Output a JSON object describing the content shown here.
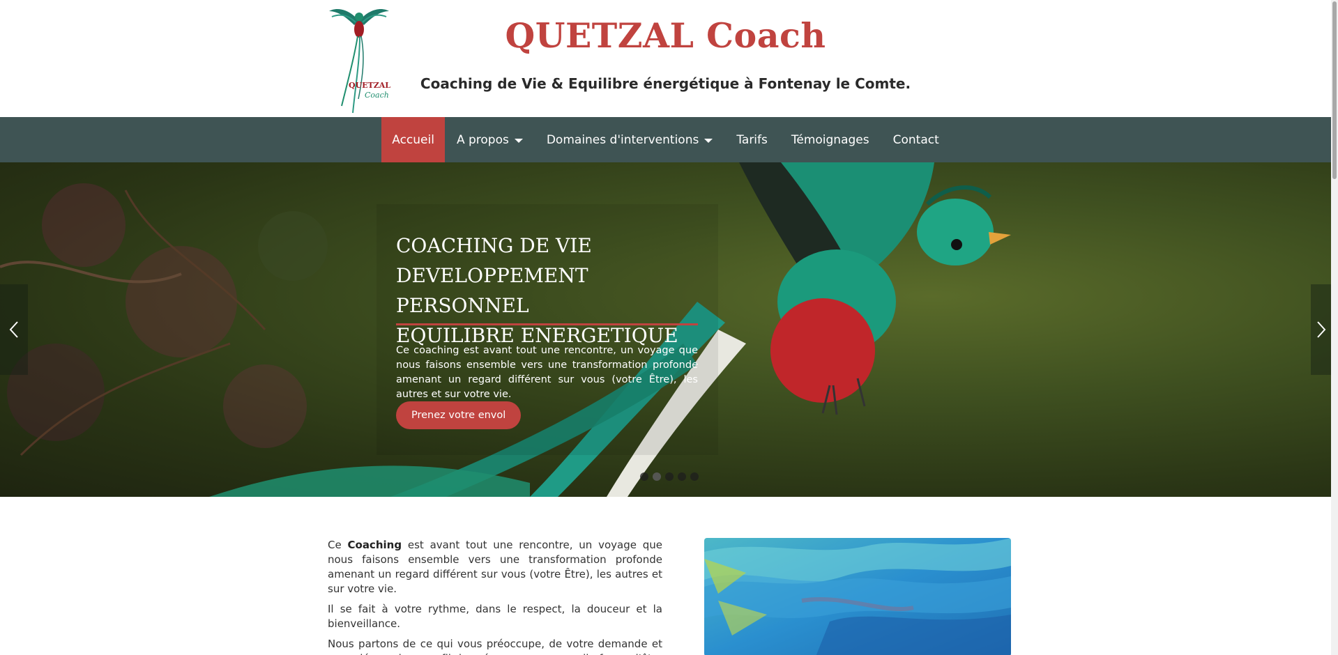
{
  "header": {
    "logo_word": "QUETZAL",
    "logo_word2": "Coach",
    "title": "QUETZAL Coach",
    "subtitle": "Coaching de Vie & Equilibre énergétique à Fontenay le Comte."
  },
  "nav": {
    "items": [
      {
        "label": "Accueil",
        "active": true
      },
      {
        "label": "A propos",
        "dropdown": true
      },
      {
        "label": "Domaines d'interventions",
        "dropdown": true
      },
      {
        "label": "Tarifs"
      },
      {
        "label": "Témoignages"
      },
      {
        "label": "Contact"
      }
    ]
  },
  "hero": {
    "title_line1": "COACHING DE VIE",
    "title_line2": "DEVELOPPEMENT PERSONNEL",
    "title_line3": "EQUILIBRE ENERGETIQUE",
    "text": "Ce coaching est avant tout une rencontre, un voyage que nous faisons ensemble vers une transformation profonde amenant un regard différent sur vous (votre Être), les autres et sur votre vie.",
    "button": "Prenez votre envol",
    "prev_icon": "chevron-left-icon",
    "next_icon": "chevron-right-icon",
    "slide_count": 5,
    "active_slide": 1
  },
  "content": {
    "p1_prefix": "Ce ",
    "p1_bold": "Coaching",
    "p1_rest": " est avant tout une rencontre, un voyage que nous faisons ensemble vers une transformation profonde amenant un regard différent sur vous (votre Être), les autres et sur votre vie.",
    "p2": "Il se fait à votre rythme, dans le respect, la douceur et la bienveillance.",
    "p3": "Nous partons de ce qui vous préoccupe, de votre demande et vous découvrirez, au fil des séances, une nouvelle façon d'être et"
  },
  "colors": {
    "accent": "#c0433f",
    "nav_bg": "#3f5454"
  }
}
